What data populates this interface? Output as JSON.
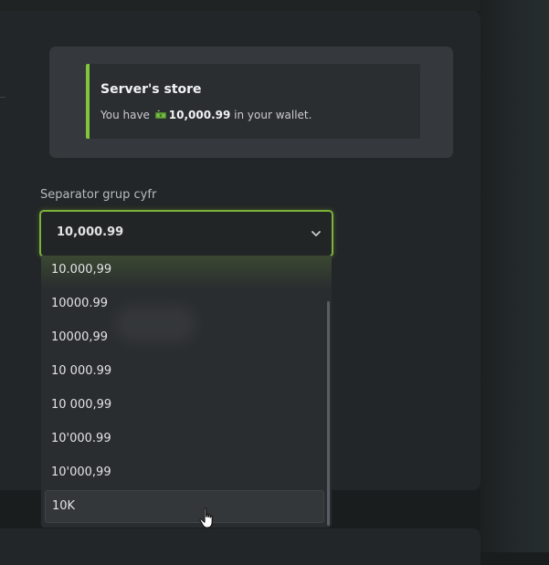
{
  "store": {
    "title": "Server's store",
    "text_prefix": "You have ",
    "amount": "10,000.99",
    "text_suffix": " in your wallet.",
    "icon": "money-icon",
    "accent_color": "#84c43d"
  },
  "separator": {
    "label": "Separator grup cyfr",
    "selected": "10,000.99",
    "options": [
      "10.000,99",
      "10000.99",
      "10000,99",
      "10 000.99",
      "10 000,99",
      "10'000.99",
      "10'000,99",
      "10K"
    ],
    "hovered_index": 7
  }
}
